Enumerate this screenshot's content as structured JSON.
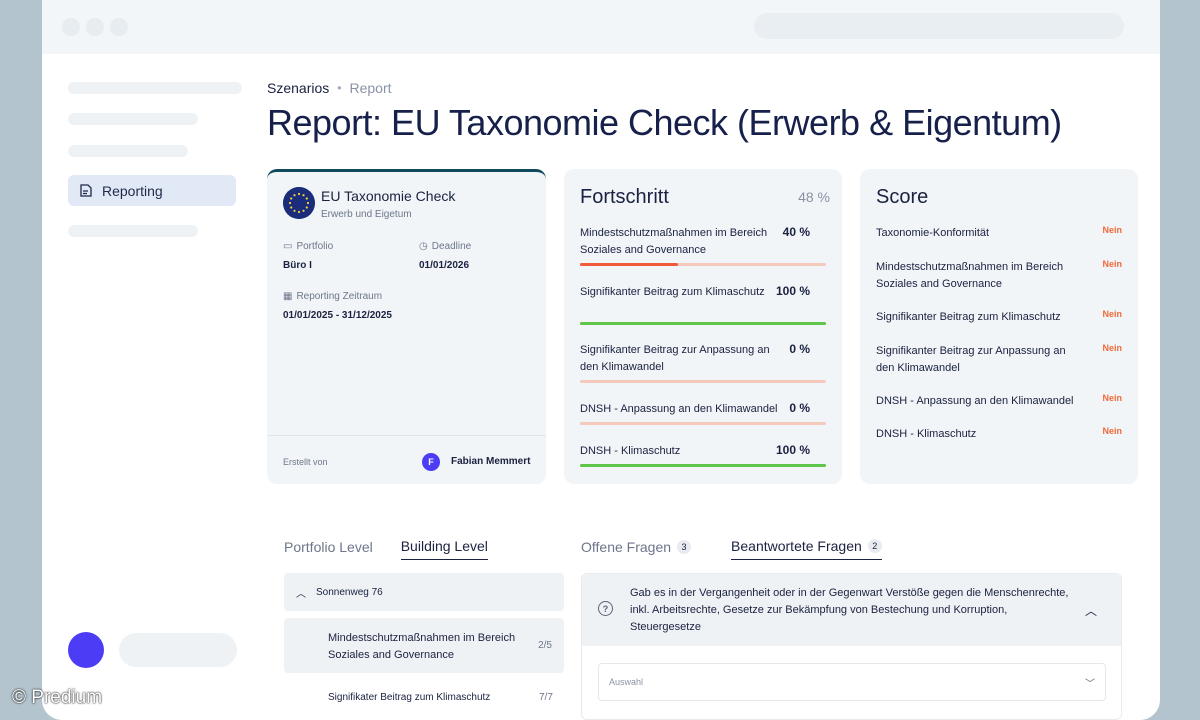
{
  "breadcrumb": {
    "item1": "Szenarios",
    "separator": "•",
    "item2": "Report"
  },
  "page_title": "Report: EU Taxonomie Check (Erwerb & Eigentum)",
  "sidebar": {
    "reporting_label": "Reporting"
  },
  "check_card": {
    "title": "EU Taxonomie Check",
    "subtitle": "Erwerb und Eigetum",
    "portfolio_label": "Portfolio",
    "portfolio_value": "Büro I",
    "deadline_label": "Deadline",
    "deadline_value": "01/01/2026",
    "period_label": "Reporting Zeitraum",
    "period_value": "01/01/2025 - 31/12/2025",
    "created_label": "Erstellt von",
    "creator_initial": "F",
    "creator_name": "Fabian Memmert"
  },
  "progress_card": {
    "title": "Fortschritt",
    "total_percent": "48 %",
    "items": [
      {
        "label": "Mindestschutzmaßnahmen im Bereich Soziales and Governance",
        "value": "40 %",
        "fraction": 0.4,
        "color": "#f05a3a"
      },
      {
        "label": "Signifikanter Beitrag zum Klimaschutz",
        "value": "100 %",
        "fraction": 1.0,
        "color": "#5ec54a"
      },
      {
        "label": "Signifikanter Beitrag zur Anpassung an den Klimawandel",
        "value": "0 %",
        "fraction": 0.0,
        "color": "#f05a3a"
      },
      {
        "label": "DNSH - Anpassung an den Klimawandel",
        "value": "0 %",
        "fraction": 0.0,
        "color": "#f05a3a"
      },
      {
        "label": "DNSH - Klimaschutz",
        "value": "100 %",
        "fraction": 1.0,
        "color": "#5ec54a"
      }
    ]
  },
  "score_card": {
    "title": "Score",
    "items": [
      {
        "label": "Taxonomie-Konformität",
        "value": "Nein"
      },
      {
        "label": "Mindestschutzmaßnahmen im Bereich Soziales and Governance",
        "value": "Nein"
      },
      {
        "label": "Signifikanter Beitrag zum Klimaschutz",
        "value": "Nein"
      },
      {
        "label": "Signifikanter Beitrag zur Anpassung an den Klimawandel",
        "value": "Nein"
      },
      {
        "label": "DNSH - Anpassung an den Klimawandel",
        "value": "Nein"
      },
      {
        "label": "DNSH - Klimaschutz",
        "value": "Nein"
      }
    ]
  },
  "level_tabs": {
    "portfolio": "Portfolio Level",
    "building": "Building Level"
  },
  "question_tabs": {
    "open": "Offene Fragen",
    "open_count": "3",
    "answered": "Beantwortete Fragen",
    "answered_count": "2"
  },
  "building": {
    "name": "Sonnenweg 76",
    "sub1_label": "Mindestschutzmaßnahmen im Bereich Soziales and Governance",
    "sub1_count": "2/5",
    "sub2_label": "Signifikater Beitrag zum Klimaschutz",
    "sub2_count": "7/7"
  },
  "question": {
    "text": "Gab es in der Vergangenheit oder in der Gegenwart Verstöße gegen die Menschenrechte, inkl. Arbeitsrechte, Gesetze zur Bekämpfung von Bestechung und Korruption, Steuergesetze",
    "select_placeholder": "Auswahl"
  },
  "watermark": "© Predium"
}
